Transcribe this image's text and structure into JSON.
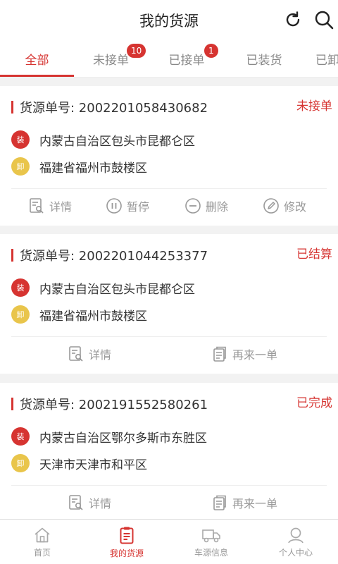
{
  "header": {
    "title": "我的货源",
    "refresh_icon": "refresh-icon",
    "search_icon": "search-icon"
  },
  "tabs": [
    {
      "label": "全部",
      "active": true
    },
    {
      "label": "未接单",
      "badge": "10"
    },
    {
      "label": "已接单",
      "badge": "1"
    },
    {
      "label": "已装货"
    },
    {
      "label": "已卸"
    }
  ],
  "cards": [
    {
      "order_label": "货源单号: 2002201058430682",
      "status": "未接单",
      "load_tag": "装",
      "load_addr": "内蒙古自治区包头市昆都仑区",
      "unload_tag": "卸",
      "unload_addr": "福建省福州市鼓楼区",
      "actions": [
        "详情",
        "暂停",
        "删除",
        "修改"
      ]
    },
    {
      "order_label": "货源单号: 2002201044253377",
      "status": "已结算",
      "load_tag": "装",
      "load_addr": "内蒙古自治区包头市昆都仑区",
      "unload_tag": "卸",
      "unload_addr": "福建省福州市鼓楼区",
      "actions": [
        "详情",
        "再来一单"
      ]
    },
    {
      "order_label": "货源单号: 2002191552580261",
      "status": "已完成",
      "load_tag": "装",
      "load_addr": "内蒙古自治区鄂尔多斯市东胜区",
      "unload_tag": "卸",
      "unload_addr": "天津市天津市和平区",
      "actions": [
        "详情",
        "再来一单"
      ]
    }
  ],
  "bottom_nav": [
    {
      "label": "首页",
      "icon": "home-icon"
    },
    {
      "label": "我的货源",
      "icon": "clipboard-icon",
      "active": true
    },
    {
      "label": "车源信息",
      "icon": "truck-icon"
    },
    {
      "label": "个人中心",
      "icon": "user-icon"
    }
  ],
  "colors": {
    "accent": "#d63431",
    "unload": "#e9c54b"
  }
}
